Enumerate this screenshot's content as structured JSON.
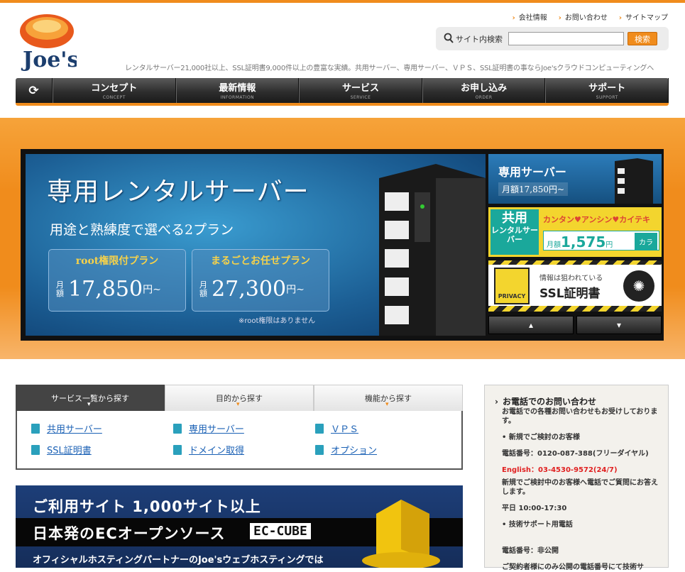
{
  "brand": {
    "logo_text": "Joe's",
    "accent": "#f08c1c"
  },
  "header": {
    "links": [
      "会社情報",
      "お問い合わせ",
      "サイトマップ"
    ],
    "search_label": "サイト内検索",
    "search_value": "",
    "search_button": "検索",
    "tagline": "レンタルサーバー21,000社以上、SSL証明書9,000件以上の豊富な実績。共用サーバー、専用サーバー、ＶＰＳ、SSL証明書の事ならJoe'sクラウドコンピューティングへ"
  },
  "nav": {
    "items": [
      {
        "jp": "コンセプト",
        "en": "CONCEPT"
      },
      {
        "jp": "最新情報",
        "en": "INFORMATION"
      },
      {
        "jp": "サービス",
        "en": "SERVICE"
      },
      {
        "jp": "お申し込み",
        "en": "ORDER"
      },
      {
        "jp": "サポート",
        "en": "SUPPORT"
      }
    ]
  },
  "banner": {
    "title": "専用レンタルサーバー",
    "subtitle": "用途と熟練度で選べる2プラン",
    "plan1": {
      "name": "root権限付プラン",
      "label": "月額",
      "price": "17,850",
      "unit": "円~"
    },
    "plan2": {
      "name": "まるごとお任せプラン",
      "label": "月額",
      "price": "27,300",
      "unit": "円~"
    },
    "note": "※root権限はありません"
  },
  "side_banners": {
    "dedicated": {
      "title": "専用サーバー",
      "price": "月額17,850円~"
    },
    "shared": {
      "tag_top": "共用",
      "tag_bottom": "レンタルサーバー",
      "catch": "カンタン♥アンシン♥カイテキ",
      "label": "月額",
      "price": "1,575",
      "unit": "円",
      "button": "カラ"
    },
    "ssl": {
      "lock_text": "PRIVACY",
      "sub": "情報は狙われている",
      "title": "SSL証明書"
    },
    "nav_up": "▴",
    "nav_down": "▾"
  },
  "tabs": {
    "headers": [
      "サービス一覧から探す",
      "目的から探す",
      "機能から探す"
    ],
    "links": [
      "共用サーバー",
      "専用サーバー",
      "ＶＰＳ",
      "SSL証明書",
      "ドメイン取得",
      "オプション"
    ]
  },
  "ec_banner": {
    "line1": "ご利用サイト 1,000サイト以上",
    "line2": "日本発のECオープンソース",
    "badge": "EC-CUBE",
    "line3": "オフィシャルホスティングパートナーのJoe'sウェブホスティングでは"
  },
  "contact": {
    "title": "お電話でのお問い合わせ",
    "intro": "お電話での各種お問い合わせもお受けしております。",
    "new_head": "• 新規でご検討のお客様",
    "tel": "電話番号：0120-087-388(フリーダイヤル)",
    "english": "English：03-4530-9572(24/7)",
    "new_desc": "新規でご検討中のお客様へ電話でご質問にお答えします。",
    "hours": "平日 10:00-17:30",
    "support_head": "• 技術サポート用電話",
    "support_tel": "電話番号：非公開",
    "support_desc": "ご契約者様にのみ公開の電話番号にて技術サ"
  }
}
